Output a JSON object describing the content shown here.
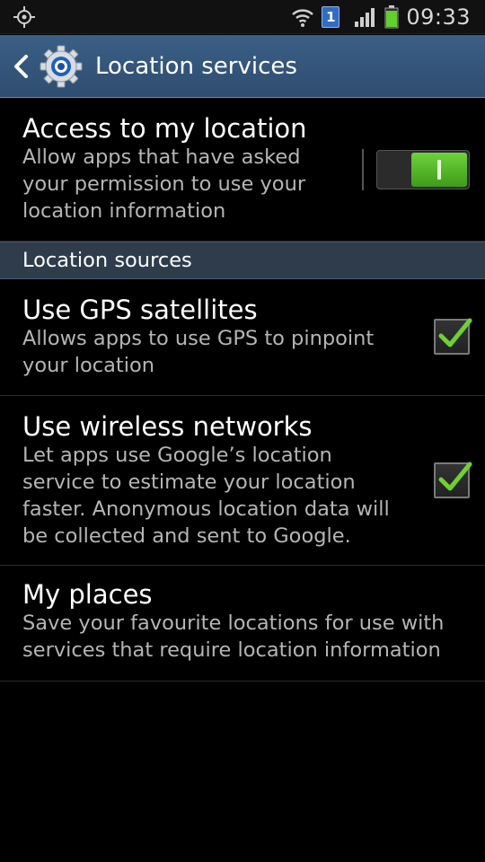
{
  "status_bar": {
    "time": "09:33",
    "sim_badge": "1",
    "icons": [
      "gps-icon",
      "wifi-icon",
      "sim-icon",
      "signal-icon",
      "battery-icon"
    ]
  },
  "action_bar": {
    "title": "Location services",
    "icons": [
      "back-chevron-icon",
      "settings-gear-icon"
    ],
    "color": "#34557a"
  },
  "access": {
    "title": "Access to my location",
    "summary": "Allow apps that have asked\nyour permission to use your\nlocation information",
    "toggle_on": true,
    "accent": "#5cbf2a"
  },
  "section": {
    "label": "Location sources"
  },
  "gps": {
    "title": "Use GPS satellites",
    "summary": "Allows apps to use GPS to pinpoint\nyour location",
    "checked": true
  },
  "wireless": {
    "title": "Use wireless networks",
    "summary": "Let apps use Google’s location\nservice to estimate your location\nfaster. Anonymous location data will\nbe collected and sent to Google.",
    "checked": true
  },
  "places": {
    "title": "My places",
    "summary": "Save your favourite locations for use with\nservices that require location information"
  }
}
